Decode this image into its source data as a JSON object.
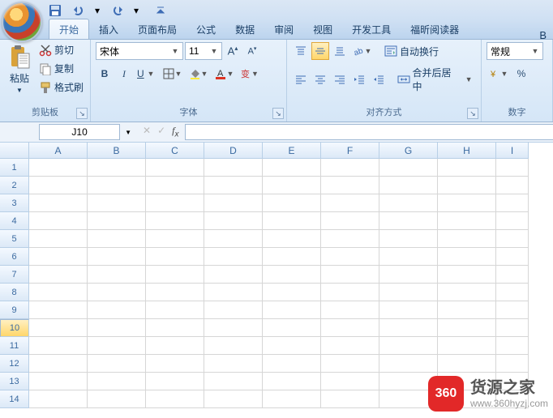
{
  "qat": {
    "tooltip_save": "保存",
    "tooltip_undo": "撤销",
    "tooltip_redo": "恢复"
  },
  "title_right": "B",
  "tabs": [
    "开始",
    "插入",
    "页面布局",
    "公式",
    "数据",
    "审阅",
    "视图",
    "开发工具",
    "福昕阅读器"
  ],
  "active_tab_index": 0,
  "clipboard": {
    "paste_label": "粘贴",
    "cut_label": "剪切",
    "copy_label": "复制",
    "format_painter_label": "格式刷",
    "group_label": "剪贴板"
  },
  "font": {
    "family": "宋体",
    "size": "11",
    "group_label": "字体",
    "bold": "B",
    "italic": "I",
    "underline": "U"
  },
  "align": {
    "wrap_label": "自动换行",
    "merge_label": "合并后居中",
    "group_label": "对齐方式"
  },
  "number": {
    "format": "常规",
    "group_label": "数字"
  },
  "namebox": {
    "cell": "J10"
  },
  "columns": [
    "A",
    "B",
    "C",
    "D",
    "E",
    "F",
    "G",
    "H",
    "I"
  ],
  "rows": [
    "1",
    "2",
    "3",
    "4",
    "5",
    "6",
    "7",
    "8",
    "9",
    "10",
    "11",
    "12",
    "13",
    "14"
  ],
  "selected_row_index": 9,
  "watermark": {
    "badge": "360",
    "title": "货源之家",
    "url": "www.360hyzj.com"
  }
}
